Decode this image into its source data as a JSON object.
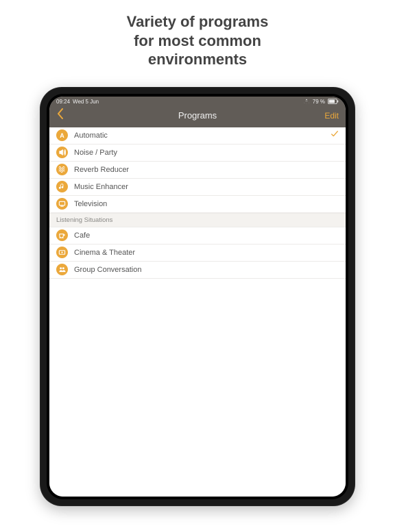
{
  "headline": {
    "line1": "Variety of programs",
    "line2": "for most common",
    "line3": "environments"
  },
  "statusBar": {
    "time": "09:24",
    "date": "Wed 5 Jun",
    "batteryText": "79 %"
  },
  "navBar": {
    "title": "Programs",
    "editLabel": "Edit"
  },
  "programs": [
    {
      "label": "Automatic",
      "iconText": "A",
      "iconType": "letter",
      "selected": true
    },
    {
      "label": "Noise / Party",
      "iconText": "",
      "iconType": "sound",
      "selected": false
    },
    {
      "label": "Reverb Reducer",
      "iconText": "",
      "iconType": "reverb",
      "selected": false
    },
    {
      "label": "Music Enhancer",
      "iconText": "",
      "iconType": "music",
      "selected": false
    },
    {
      "label": "Television",
      "iconText": "",
      "iconType": "tv",
      "selected": false
    }
  ],
  "sectionHeader": "Listening Situations",
  "situations": [
    {
      "label": "Cafe",
      "iconType": "cup"
    },
    {
      "label": "Cinema & Theater",
      "iconType": "ticket"
    },
    {
      "label": "Group Conversation",
      "iconType": "group"
    }
  ]
}
